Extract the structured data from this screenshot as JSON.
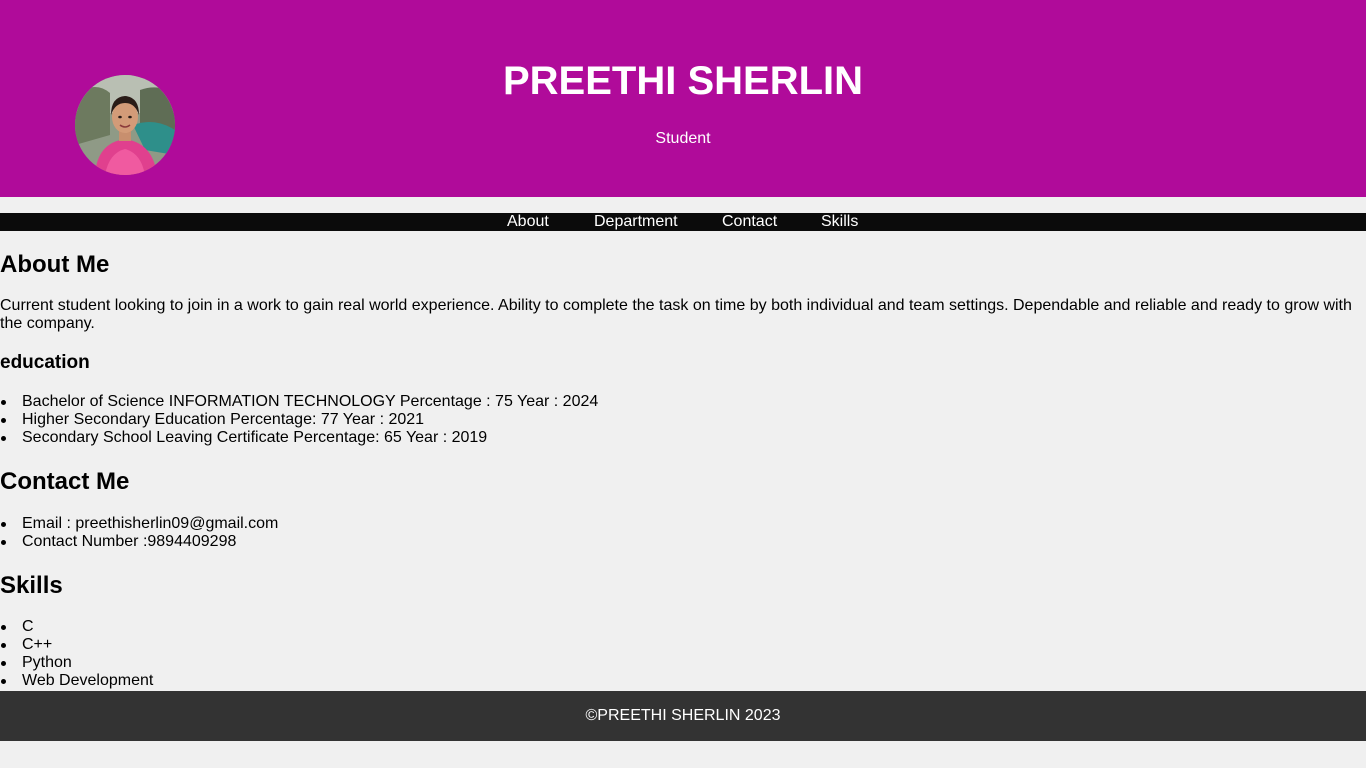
{
  "header": {
    "title": "PREETHI SHERLIN",
    "subtitle": "Student",
    "background_color": "#b00b9a",
    "avatar": "profile-photo"
  },
  "nav": {
    "background_color": "#0b0b0b",
    "items": [
      {
        "label": "About"
      },
      {
        "label": "Department"
      },
      {
        "label": "Contact"
      },
      {
        "label": "Skills"
      }
    ]
  },
  "about": {
    "heading": "About Me",
    "text": "Current student looking to join in a work to gain real world experience. Ability to complete the task on time by both individual and team settings. Dependable and reliable and ready to grow with the company."
  },
  "education": {
    "heading": "education",
    "items": [
      "Bachelor of Science INFORMATION TECHNOLOGY Percentage : 75 Year : 2024",
      "Higher Secondary Education Percentage: 77 Year : 2021",
      "Secondary School Leaving Certificate Percentage: 65 Year : 2019"
    ]
  },
  "contact": {
    "heading": "Contact Me",
    "items": [
      "Email : preethisherlin09@gmail.com",
      "Contact Number :9894409298"
    ]
  },
  "skills": {
    "heading": "Skills",
    "items": [
      "C",
      "C++",
      "Python",
      "Web Development"
    ]
  },
  "footer": {
    "text": "©PREETHI SHERLIN 2023",
    "background_color": "#333333"
  }
}
